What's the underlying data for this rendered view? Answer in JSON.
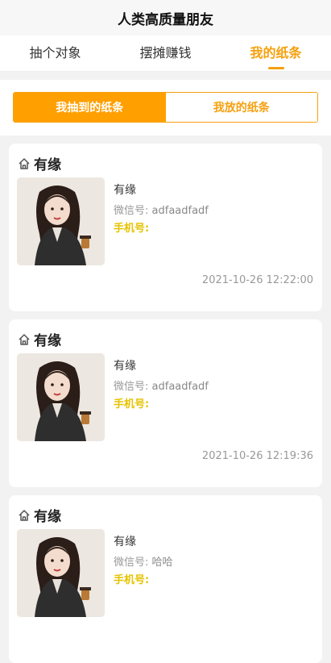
{
  "app": {
    "title": "人类高质量朋友"
  },
  "tabs": [
    {
      "label": "抽个对象",
      "active": false
    },
    {
      "label": "摆摊赚钱",
      "active": false
    },
    {
      "label": "我的纸条",
      "active": true
    }
  ],
  "segment": {
    "left_label": "我抽到的纸条",
    "right_label": "我放的纸条"
  },
  "colors": {
    "accent": "#ff9f00",
    "phone": "#e6c300"
  },
  "cards": [
    {
      "title": "有缘",
      "nickname": "有缘",
      "wechat_label": "微信号:",
      "wechat_value": "adfaadfadf",
      "phone_label": "手机号:",
      "time": "2021-10-26 12:22:00"
    },
    {
      "title": "有缘",
      "nickname": "有缘",
      "wechat_label": "微信号:",
      "wechat_value": "adfaadfadf",
      "phone_label": "手机号:",
      "time": "2021-10-26 12:19:36"
    },
    {
      "title": "有缘",
      "nickname": "有缘",
      "wechat_label": "微信号:",
      "wechat_value": "哈哈",
      "phone_label": "手机号:",
      "time": ""
    }
  ]
}
